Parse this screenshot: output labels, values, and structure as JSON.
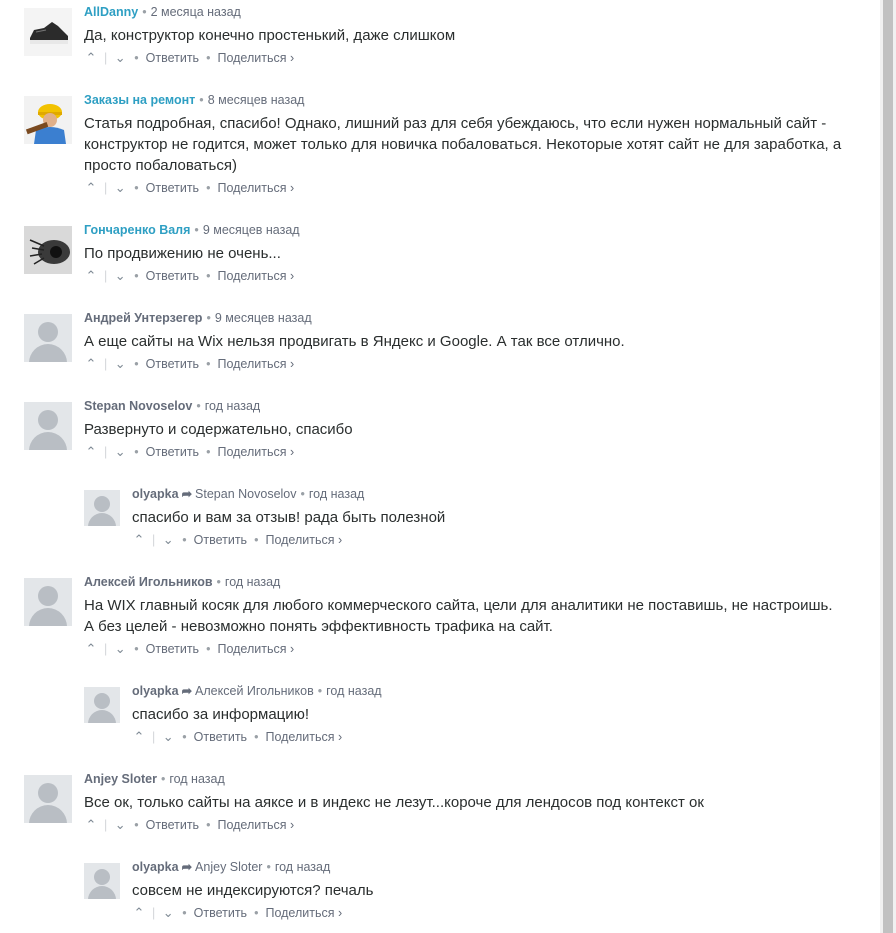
{
  "comments": [
    {
      "author": "AllDanny",
      "author_link": true,
      "time": "2 месяца назад",
      "text": "Да, конструктор конечно простенький, даже слишком",
      "avatar": "sneaker-avatar"
    },
    {
      "author": "Заказы на ремонт",
      "author_link": true,
      "time": "8 месяцев назад",
      "text": "Статья подробная, спасибо! Однако, лишний раз для себя убеждаюсь, что если нужен нормальный сайт - конструктор не годится, может только для новичка побаловаться. Некоторые хотят сайт не для заработка, а просто побаловаться)",
      "avatar": "worker-avatar"
    },
    {
      "author": "Гончаренко Валя",
      "author_link": true,
      "time": "9 месяцев назад",
      "text": "По продвижению не очень...",
      "avatar": "eye-avatar"
    },
    {
      "author": "Андрей Унтерзегер",
      "author_link": false,
      "time": "9 месяцев назад",
      "text": "А еще сайты на Wix нельзя продвигать в Яндекс и Google. А так все отлично.",
      "avatar": "generic"
    },
    {
      "author": "Stepan Novoselov",
      "author_link": false,
      "time": "год назад",
      "text": "Развернуто и содержательно, спасибо",
      "avatar": "generic"
    },
    {
      "author": "olyapka",
      "author_link": false,
      "reply_to": "Stepan Novoselov",
      "time": "год назад",
      "text": "спасибо и вам за отзыв! рада быть полезной",
      "avatar": "generic"
    },
    {
      "author": "Алексей Игольников",
      "author_link": false,
      "time": "год назад",
      "text": "На WIX главный косяк для любого коммерческого сайта, цели для аналитики не поставишь, не настроишь. А без целей - невозможно понять эффективность трафика на сайт.",
      "avatar": "generic"
    },
    {
      "author": "olyapka",
      "author_link": false,
      "reply_to": "Алексей Игольников",
      "time": "год назад",
      "text": "спасибо за информацию!",
      "avatar": "generic"
    },
    {
      "author": "Anjey Sloter",
      "author_link": false,
      "time": "год назад",
      "text": "Все ок, только сайты на аяксе и в индекс не лезут...короче для лендосов под контекст ок",
      "avatar": "generic"
    },
    {
      "author": "olyapka",
      "author_link": false,
      "reply_to": "Anjey Sloter",
      "time": "год назад",
      "text": "совсем не индексируются? печаль",
      "avatar": "generic"
    }
  ],
  "actions": {
    "reply": "Ответить",
    "share": "Поделиться ›",
    "upvote": "^",
    "downvote": "v",
    "separator": "|",
    "dot": "•",
    "bullet": "•"
  },
  "colors": {
    "author_link": "#2e9fc3",
    "muted": "#656c7a",
    "text": "#2a2e2e"
  }
}
